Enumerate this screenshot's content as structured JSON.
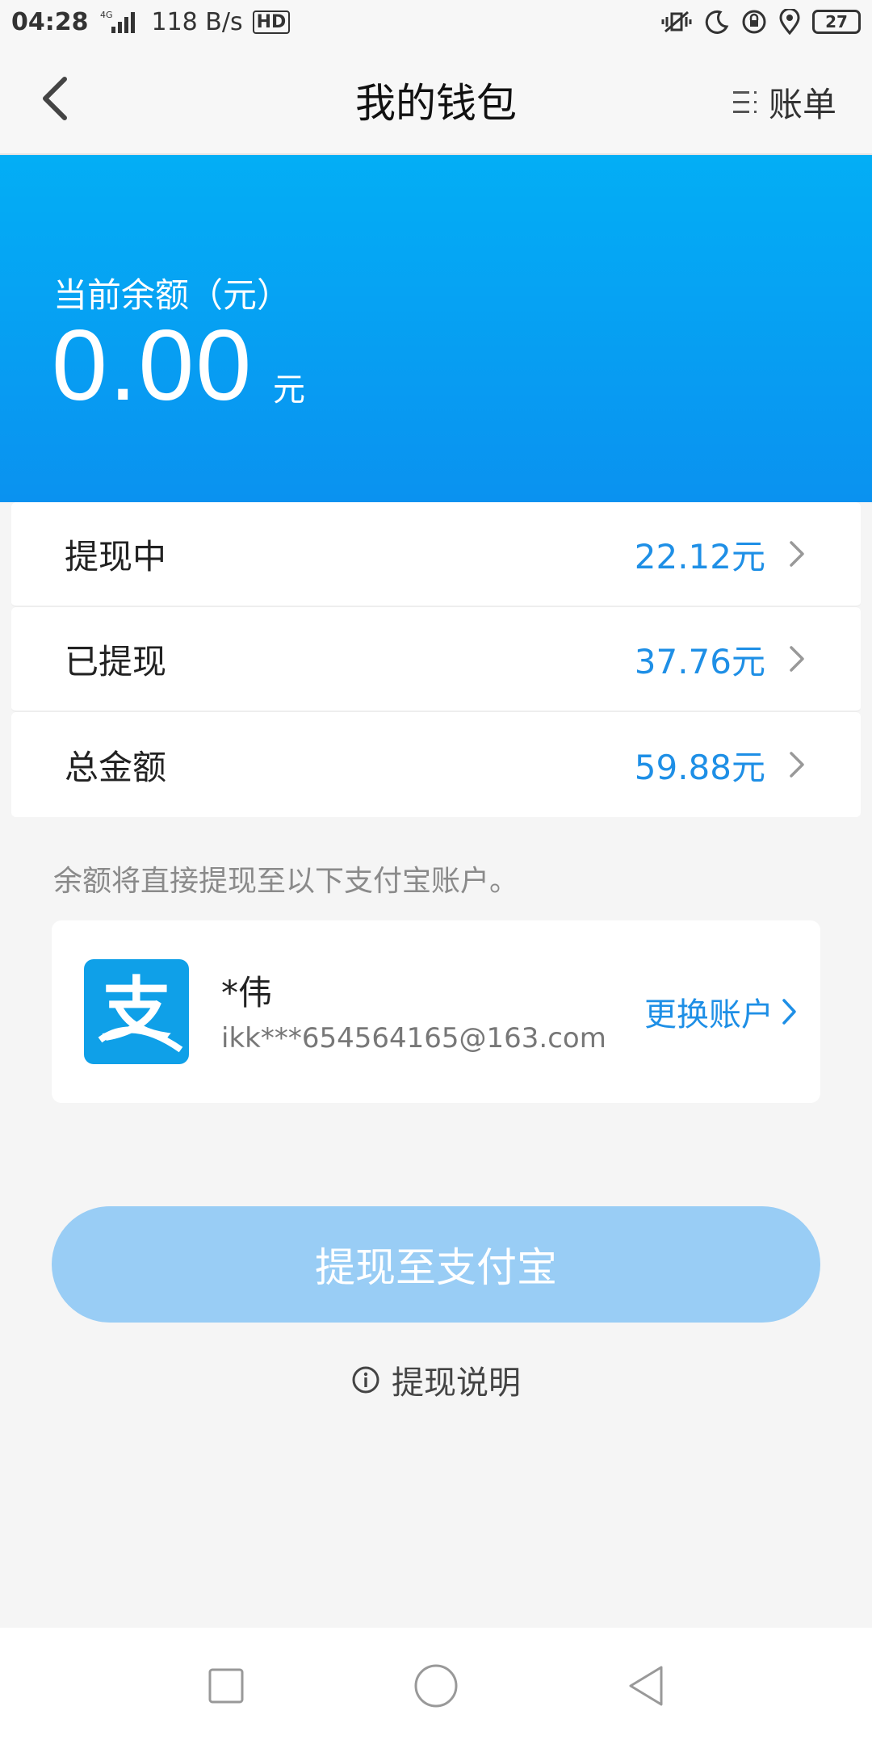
{
  "status_bar": {
    "time": "04:28",
    "network": "4G",
    "speed": "118 B/s",
    "hd": "HD",
    "battery": "27"
  },
  "header": {
    "title": "我的钱包",
    "bill_label": "账单"
  },
  "balance": {
    "label": "当前余额（元）",
    "value": "0.00",
    "unit": "元"
  },
  "rows": [
    {
      "label": "提现中",
      "value": "22.12元"
    },
    {
      "label": "已提现",
      "value": "37.76元"
    },
    {
      "label": "总金额",
      "value": "59.88元"
    }
  ],
  "note": "余额将直接提现至以下支付宝账户。",
  "account": {
    "logo_char": "支",
    "name": "*伟",
    "email": "ikk***654564165@163.com",
    "change_label": "更换账户"
  },
  "withdraw_button": "提现至支付宝",
  "explain_label": "提现说明",
  "colors": {
    "banner": "#03aef5",
    "accent": "#1e8fe6",
    "button_disabled": "#99cdf5"
  }
}
